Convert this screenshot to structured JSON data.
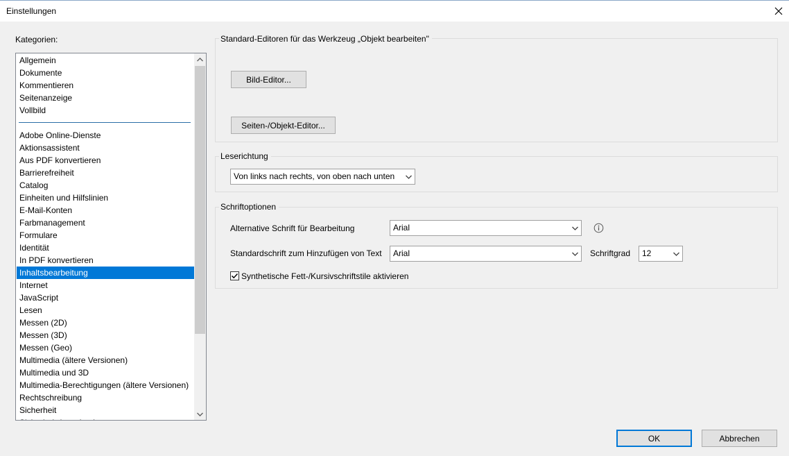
{
  "window": {
    "title": "Einstellungen"
  },
  "categories": {
    "label": "Kategorien:",
    "group1": [
      "Allgemein",
      "Dokumente",
      "Kommentieren",
      "Seitenanzeige",
      "Vollbild"
    ],
    "group2": [
      "Adobe Online-Dienste",
      "Aktionsassistent",
      "Aus PDF konvertieren",
      "Barrierefreiheit",
      "Catalog",
      "Einheiten und Hilfslinien",
      "E-Mail-Konten",
      "Farbmanagement",
      "Formulare",
      "Identität",
      "In PDF konvertieren",
      "Inhaltsbearbeitung",
      "Internet",
      "JavaScript",
      "Lesen",
      "Messen (2D)",
      "Messen (3D)",
      "Messen (Geo)",
      "Multimedia (ältere Versionen)",
      "Multimedia und 3D",
      "Multimedia-Berechtigungen (ältere Versionen)",
      "Rechtschreibung",
      "Sicherheit",
      "Sicherheit (erweitert)"
    ],
    "selected": "Inhaltsbearbeitung"
  },
  "editors": {
    "title": "Standard-Editoren für das Werkzeug „Objekt bearbeiten\"",
    "image_editor_button": "Bild-Editor...",
    "page_object_editor_button": "Seiten-/Objekt-Editor..."
  },
  "reading": {
    "title": "Leserichtung",
    "direction_value": "Von links nach rechts, von oben nach unten"
  },
  "fonts": {
    "title": "Schriftoptionen",
    "alt_font_label": "Alternative Schrift für Bearbeitung",
    "alt_font_value": "Arial",
    "default_font_label": "Standardschrift zum Hinzufügen von Text",
    "default_font_value": "Arial",
    "size_label": "Schriftgrad",
    "size_value": "12",
    "synthetic_label": "Synthetische Fett-/Kursivschriftstile aktivieren",
    "synthetic_checked": true
  },
  "footer": {
    "ok_label": "OK",
    "cancel_label": "Abbrechen"
  },
  "icons": {
    "close": "close-icon",
    "info": "info-icon",
    "dropdown": "chevron-down-icon",
    "check": "check-icon"
  },
  "colors": {
    "selection": "#0078d7",
    "separator": "#2a6ea6"
  }
}
